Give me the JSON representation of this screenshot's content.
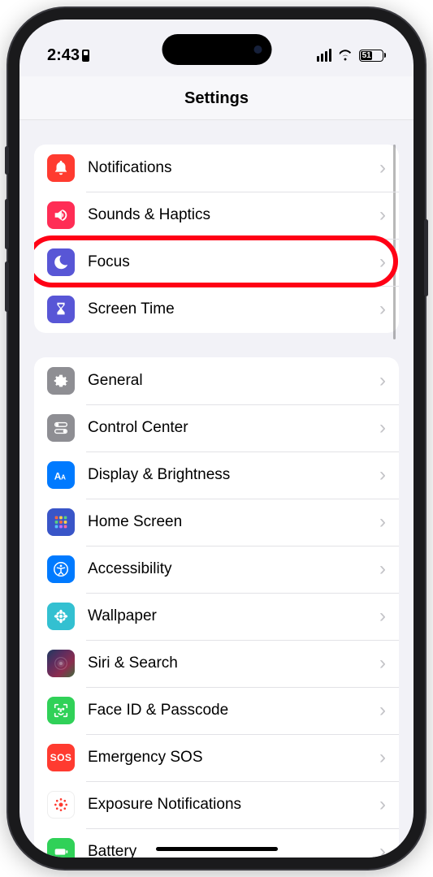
{
  "status": {
    "time": "2:43",
    "battery_pct": "51"
  },
  "header": {
    "title": "Settings"
  },
  "groups": [
    {
      "items": [
        {
          "label": "Notifications",
          "icon_name": "bell-icon",
          "bg": "#ff3b30"
        },
        {
          "label": "Sounds & Haptics",
          "icon_name": "speaker-icon",
          "bg": "#ff2d55"
        },
        {
          "label": "Focus",
          "icon_name": "moon-icon",
          "bg": "#5856d6",
          "highlighted": true
        },
        {
          "label": "Screen Time",
          "icon_name": "hourglass-icon",
          "bg": "#5856d6"
        }
      ]
    },
    {
      "items": [
        {
          "label": "General",
          "icon_name": "gear-icon",
          "bg": "#8e8e93"
        },
        {
          "label": "Control Center",
          "icon_name": "switches-icon",
          "bg": "#8e8e93"
        },
        {
          "label": "Display & Brightness",
          "icon_name": "text-size-icon",
          "bg": "#007aff"
        },
        {
          "label": "Home Screen",
          "icon_name": "apps-grid-icon",
          "bg": "#3955c8"
        },
        {
          "label": "Accessibility",
          "icon_name": "accessibility-icon",
          "bg": "#007aff"
        },
        {
          "label": "Wallpaper",
          "icon_name": "flower-icon",
          "bg": "#33c0d1"
        },
        {
          "label": "Siri & Search",
          "icon_name": "siri-icon",
          "bg": "siri"
        },
        {
          "label": "Face ID & Passcode",
          "icon_name": "face-id-icon",
          "bg": "#30d158"
        },
        {
          "label": "Emergency SOS",
          "icon_name": "sos-icon",
          "bg": "#ff3b30",
          "text_icon": "SOS"
        },
        {
          "label": "Exposure Notifications",
          "icon_name": "exposure-icon",
          "bg": "exposure"
        },
        {
          "label": "Battery",
          "icon_name": "battery-icon",
          "bg": "#30d158"
        }
      ]
    }
  ]
}
